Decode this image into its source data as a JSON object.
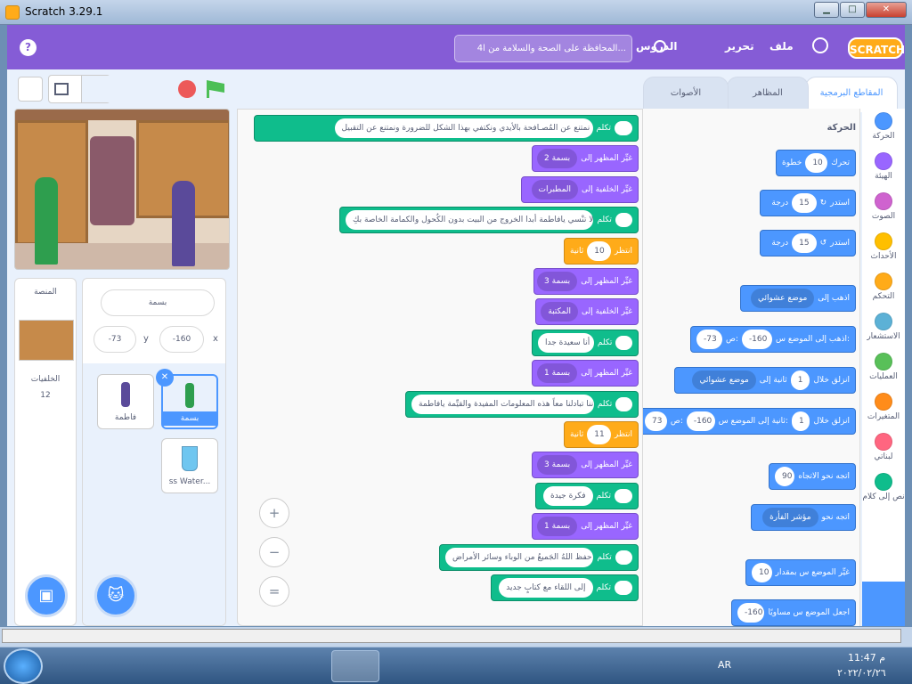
{
  "window": {
    "title": "Scratch 3.29.1",
    "min": "▁",
    "max": "□",
    "close": "✕"
  },
  "menu": {
    "file": "ملف",
    "edit": "تحرير",
    "tutorials": "الدروس",
    "project_title": "4المحافظة على الصحة والسلامة من ا...",
    "logo": "SCRATCH",
    "help": "?"
  },
  "tabs": {
    "code": "المقاطع البرمجية",
    "costumes": "المظاهر",
    "sounds": "الأصوات"
  },
  "categories": [
    {
      "label": "الحركة",
      "color": "#4c97ff"
    },
    {
      "label": "الهيئة",
      "color": "#9966ff"
    },
    {
      "label": "الصوت",
      "color": "#cf63cf"
    },
    {
      "label": "الأحداث",
      "color": "#ffbf00"
    },
    {
      "label": "التحكم",
      "color": "#ffab19"
    },
    {
      "label": "الاستشعار",
      "color": "#5cb1d6"
    },
    {
      "label": "العمليات",
      "color": "#59c059"
    },
    {
      "label": "المتغيرات",
      "color": "#ff8c1a"
    },
    {
      "label": "لبناتي",
      "color": "#ff6680"
    },
    {
      "label": "نص إلى كلام",
      "color": "#0fbd8c"
    }
  ],
  "palette": {
    "heading": "الحركة",
    "move": {
      "text": "تحرك",
      "value": "10",
      "suffix": "خطوة"
    },
    "turn_right": {
      "text": "استدر",
      "value": "15",
      "suffix": "درجة"
    },
    "turn_left": {
      "text": "استدر",
      "value": "15",
      "suffix": "درجة"
    },
    "goto": {
      "text": "اذهب إلى",
      "drop": "موضع عشوائي"
    },
    "goto_xy": {
      "text": "اذهب إلى الموضع س:",
      "x": "-160",
      "ymid": "ص:",
      "y": "-73"
    },
    "glide": {
      "text": "انزلق خلال",
      "value": "1",
      "mid": "ثانية إلى",
      "drop": "موضع عشوائي"
    },
    "glide_xy": {
      "text": "انزلق خلال",
      "value": "1",
      "mid": "ثانية إلى الموضع س:",
      "x": "-160",
      "ymid": "ص:",
      "y": "73"
    },
    "point": {
      "text": "اتجه نحو الاتجاه",
      "value": "90"
    },
    "point_toward": {
      "text": "اتجه نحو",
      "drop": "مؤشر الفأرة"
    },
    "change_x": {
      "text": "غيِّر الموضع س بمقدار",
      "value": "10"
    },
    "set_x": {
      "text": "اجعل الموضع س مساويًا",
      "value": "-160"
    }
  },
  "script": [
    {
      "type": "ext",
      "label": "تكلم",
      "value": "ومع ظهور وباء الكُورُونا نمتنع عن المُصـافحة بالأيدي ونكتفي بهذا الشكل للضرورة ونمتنع عن التقبيل"
    },
    {
      "type": "looks",
      "label": "غيِّر المظهر إلى",
      "drop": "بسمة 2"
    },
    {
      "type": "looks",
      "label": "غيِّر الخلفية إلى",
      "drop": "المطبرات"
    },
    {
      "type": "ext",
      "label": "تكلم",
      "value": "ولا تنْسي يافاطمة أبدا الخروج من البيت بدون الكُحول والكمامة الخاصة بكِ"
    },
    {
      "type": "control",
      "label": "انتظر",
      "value": "10",
      "suffix": "ثانية"
    },
    {
      "type": "looks",
      "label": "غيِّر المظهر إلى",
      "drop": "بسمة 3"
    },
    {
      "type": "looks",
      "label": "غيِّر الخلفية إلى",
      "drop": "المكتبة"
    },
    {
      "type": "ext",
      "label": "تكلم",
      "value": "أنا سعيدة جدا"
    },
    {
      "type": "looks",
      "label": "غيِّر المظهر إلى",
      "drop": "بسمة 1"
    },
    {
      "type": "ext",
      "label": "تكلم",
      "value": "بأننا تبادلنا معاً هذه المعلومات المفيدة والقيِّمة يافاطمة"
    },
    {
      "type": "control",
      "label": "انتظر",
      "value": "11",
      "suffix": "ثانية"
    },
    {
      "type": "looks",
      "label": "غيِّر المظهر إلى",
      "drop": "بسمة 3"
    },
    {
      "type": "ext",
      "label": "تكلم",
      "value": "فكرة جيدة"
    },
    {
      "type": "looks",
      "label": "غيِّر المظهر إلى",
      "drop": "بسمة 1"
    },
    {
      "type": "ext",
      "label": "تكلم",
      "value": "حفظ اللهُ الجَميعُ من الوباء وسائر الأمراض"
    },
    {
      "type": "ext",
      "label": "تكلم",
      "value": "إلى اللقاء مع كتابٍ جديد"
    }
  ],
  "zoom": {
    "in": "+",
    "out": "−",
    "reset": "="
  },
  "sprite_info": {
    "name": "بسمة",
    "x_label": "x",
    "x": "-160",
    "y_label": "y",
    "y": "-73"
  },
  "sprites": [
    {
      "name": "بسمة",
      "selected": true
    },
    {
      "name": "فاطمة",
      "selected": false
    },
    {
      "name": "ss Water...",
      "selected": false
    }
  ],
  "stage_panel": {
    "title": "المنصة",
    "backdrops_label": "الخلفيات",
    "backdrops_count": "12"
  },
  "taskbar": {
    "lang": "AR",
    "time": "11:47 م",
    "date": "٢٠٢٢/٠٢/٢٦"
  }
}
